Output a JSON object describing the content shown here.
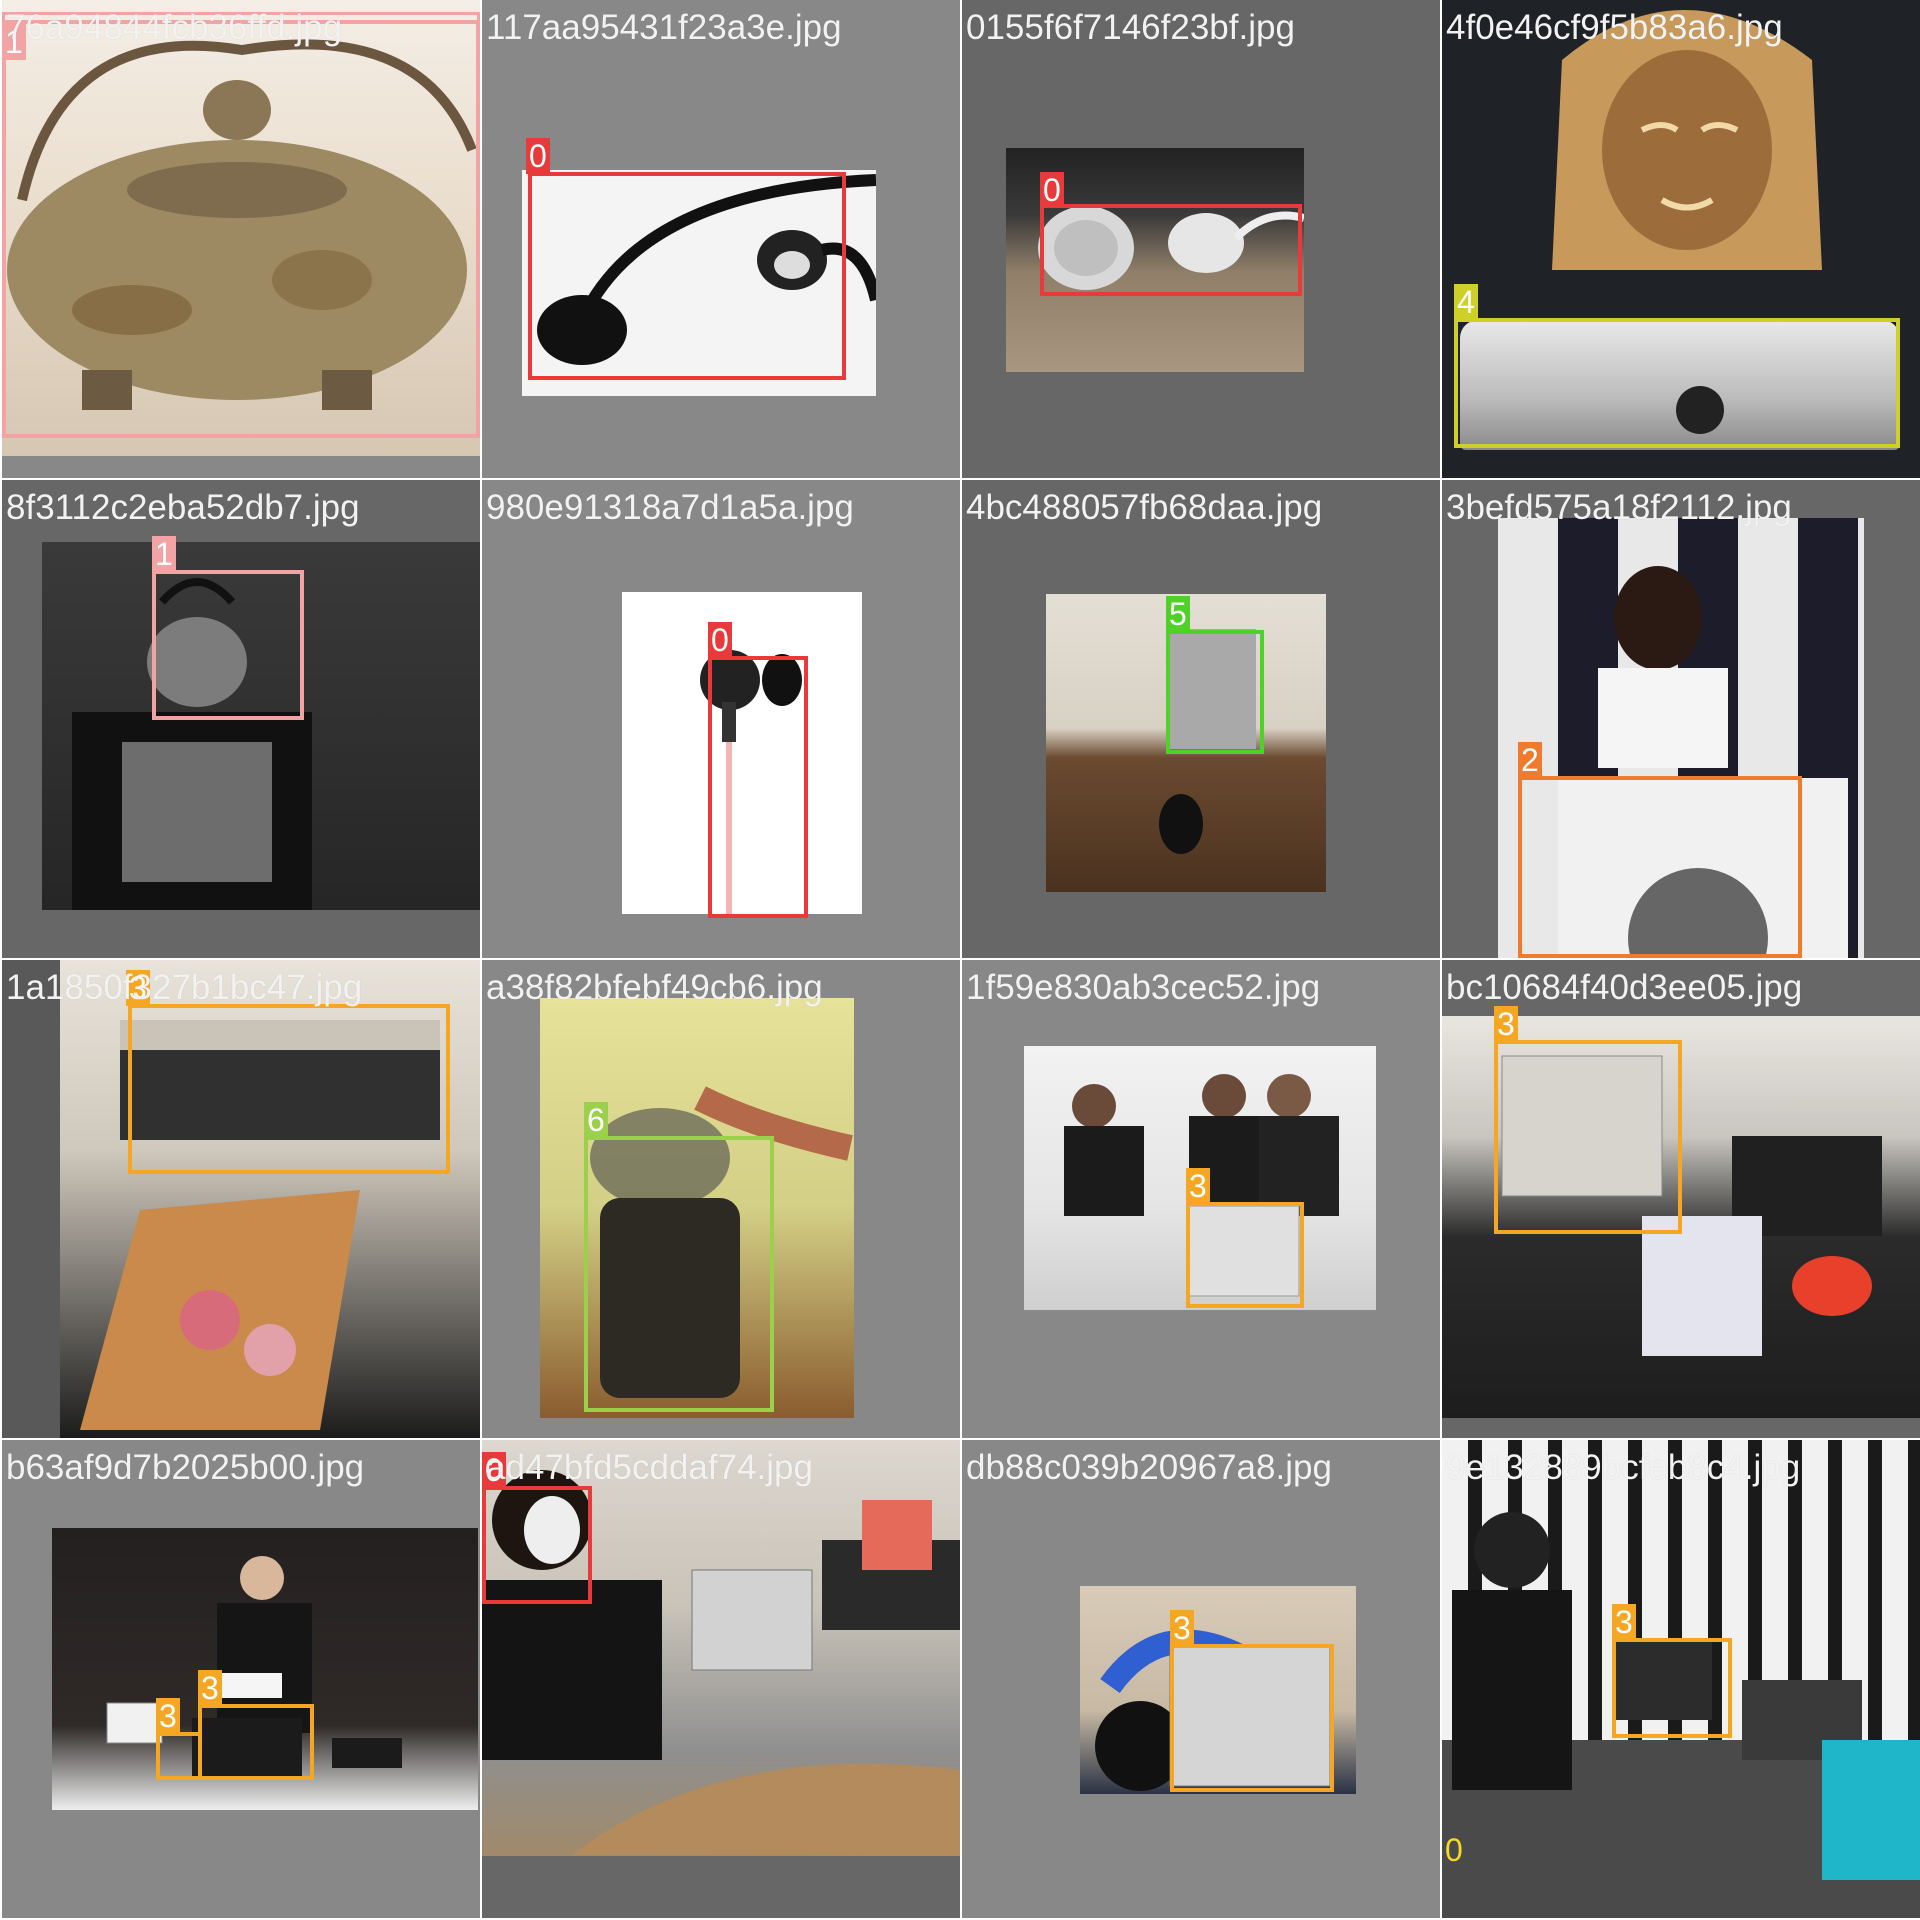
{
  "colors": {
    "c0": "#e83a3a",
    "c1": "#f2a3a3",
    "c2": "#f07b2c",
    "c3": "#f5a623",
    "c4": "#cfcf2a",
    "c5": "#4fd12a",
    "c6": "#9bd14a"
  },
  "tiles": [
    {
      "file": "76a94844fcb36ffd.jpg",
      "labels": [
        "1"
      ]
    },
    {
      "file": "117aa95431f23a3e.jpg",
      "labels": [
        "0"
      ]
    },
    {
      "file": "0155f6f7146f23bf.jpg",
      "labels": [
        "0"
      ]
    },
    {
      "file": "4f0e46cf9f5b83a6.jpg",
      "labels": [
        "4"
      ]
    },
    {
      "file": "8f3112c2eba52db7.jpg",
      "labels": [
        "1"
      ]
    },
    {
      "file": "980e91318a7d1a5a.jpg",
      "labels": [
        "0"
      ]
    },
    {
      "file": "4bc488057fb68daa.jpg",
      "labels": [
        "5"
      ]
    },
    {
      "file": "3befd575a18f2112.jpg",
      "labels": [
        "2"
      ]
    },
    {
      "file": "1a1850f327b1bc47.jpg",
      "labels": [
        "3"
      ]
    },
    {
      "file": "a38f82bfebf49cb6.jpg",
      "labels": [
        "6"
      ]
    },
    {
      "file": "1f59e830ab3cec52.jpg",
      "labels": [
        "3"
      ]
    },
    {
      "file": "bc10684f40d3ee05.jpg",
      "labels": [
        "3"
      ]
    },
    {
      "file": "b63af9d7b2025b00.jpg",
      "labels": [
        "3",
        "3"
      ]
    },
    {
      "file": "ad47bfd5cddaf74.jpg",
      "labels": [
        "0"
      ]
    },
    {
      "file": "db88c039b20967a8.jpg",
      "labels": [
        "3"
      ]
    },
    {
      "file": "9e132889bcfeb8c4.jpg",
      "labels": [
        "3",
        "0"
      ]
    }
  ]
}
